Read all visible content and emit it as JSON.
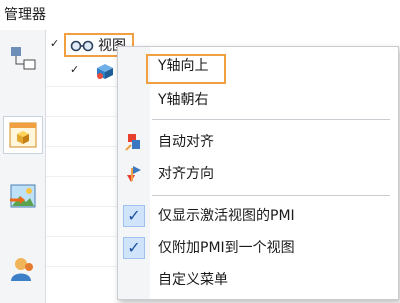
{
  "window": {
    "title": "管理器"
  },
  "tree": {
    "view_node_label": "视图"
  },
  "menu": {
    "items": [
      {
        "label": "Y轴向上",
        "highlighted": true
      },
      {
        "label": "Y轴朝右"
      },
      {
        "label": "自动对齐",
        "icon": "auto-align-icon"
      },
      {
        "label": "对齐方向",
        "icon": "align-direction-icon"
      },
      {
        "label": "仅显示激活视图的PMI",
        "checked": true
      },
      {
        "label": "仅附加PMI到一个视图",
        "checked": true
      },
      {
        "label": "自定义菜单"
      }
    ]
  },
  "colors": {
    "highlight_border": "#f0a040",
    "check_bg": "#cfe3fb"
  }
}
